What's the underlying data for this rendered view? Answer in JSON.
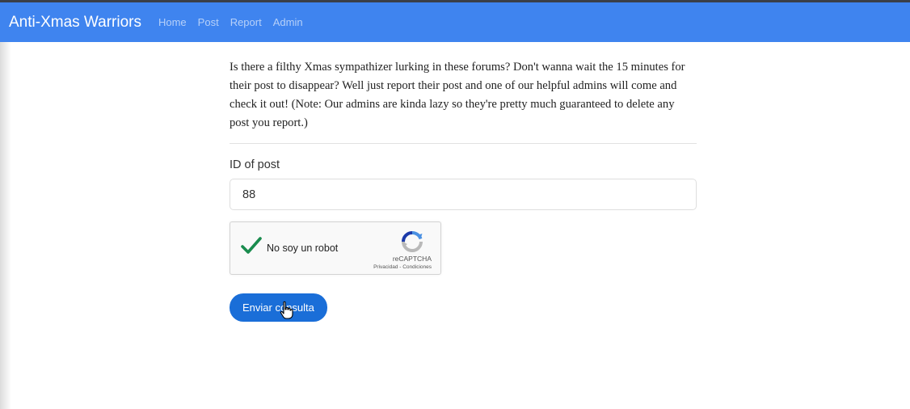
{
  "navbar": {
    "brand": "Anti-Xmas Warriors",
    "links": [
      "Home",
      "Post",
      "Report",
      "Admin"
    ]
  },
  "main": {
    "intro": "Is there a filthy Xmas sympathizer lurking in these forums? Don't wanna wait the 15 minutes for their post to disappear? Well just report their post and one of our helpful admins will come and check it out! (Note: Our admins are kinda lazy so they're pretty much guaranteed to delete any post you report.)",
    "post_id_label": "ID of post",
    "post_id_value": "88",
    "recaptcha": {
      "label": "No soy un robot",
      "brand": "reCAPTCHA",
      "links": "Privacidad - Condiciones",
      "checked": true
    },
    "submit_label": "Enviar consulta"
  },
  "colors": {
    "navbar": "#3f84ef",
    "button": "#1a6ed8",
    "check": "#1a8c4e"
  },
  "icons": [
    "check-icon",
    "recaptcha-logo-icon",
    "hand-cursor-icon"
  ]
}
